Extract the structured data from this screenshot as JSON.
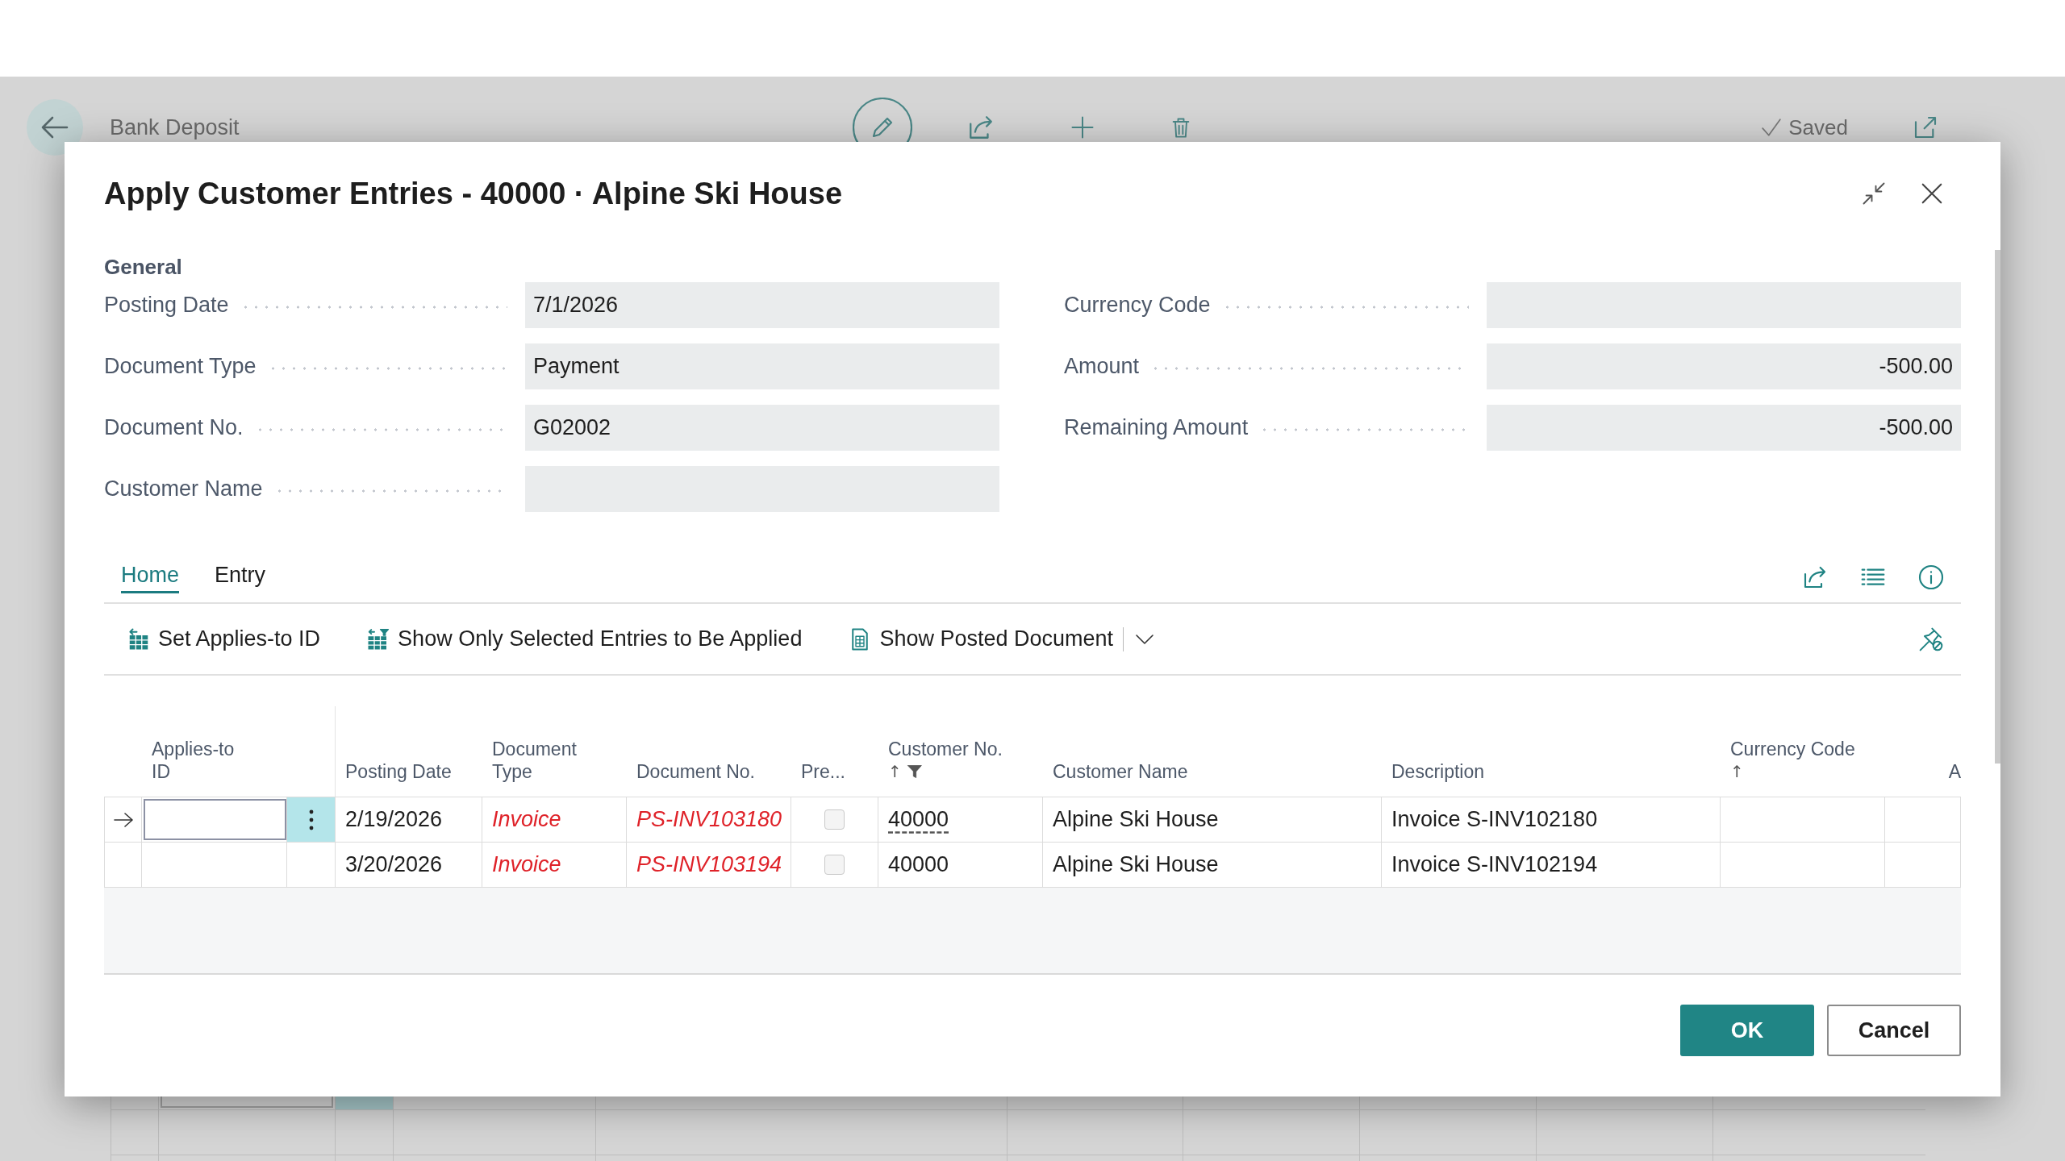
{
  "background_page": {
    "title": "Bank Deposit",
    "status": "Saved"
  },
  "dialog": {
    "title": "Apply Customer Entries - 40000 · Alpine Ski House",
    "group": "General",
    "left_fields": [
      {
        "label": "Posting Date",
        "value": "7/1/2026",
        "kind": "text"
      },
      {
        "label": "Document Type",
        "value": "Payment",
        "kind": "text"
      },
      {
        "label": "Document No.",
        "value": "G02002",
        "kind": "text"
      },
      {
        "label": "Customer Name"
      }
    ],
    "right_fields": [
      {
        "label": "Currency Code"
      },
      {
        "label": "Amount",
        "value": "-500.00",
        "kind": "amount"
      },
      {
        "label": "Remaining Amount",
        "value": "-500.00",
        "kind": "amount"
      }
    ],
    "tabs": [
      {
        "label": "Home",
        "selected": true
      },
      {
        "label": "Entry",
        "selected": false
      }
    ],
    "actions": [
      {
        "label": "Set Applies-to ID",
        "menu": false
      },
      {
        "label": "Show Only Selected Entries to Be Applied",
        "menu": false
      },
      {
        "label": "Show Posted Document",
        "menu": true
      }
    ],
    "table": {
      "columns": [
        {
          "label": "Applies-to ID"
        },
        {
          "label": "Posting Date"
        },
        {
          "label": "Document Type"
        },
        {
          "label": "Document No."
        },
        {
          "label": "Pre..."
        },
        {
          "label": "Customer No.",
          "sort_indicator": "↑",
          "filtered": true
        },
        {
          "label": "Customer Name"
        },
        {
          "label": "Description"
        },
        {
          "label": "Currency Code",
          "sort_indicator": "↑"
        },
        {
          "label": "A"
        }
      ],
      "rows": [
        {
          "selected": true,
          "posting_date": "2/19/2026",
          "document_type": "Invoice",
          "document_no": "PS-INV103180",
          "attention": true,
          "checked": false,
          "customer_no": "40000",
          "customer_name": "Alpine Ski House",
          "description": "Invoice S-INV102180"
        },
        {
          "selected": false,
          "posting_date": "3/20/2026",
          "document_type": "Invoice",
          "document_no": "PS-INV103194",
          "attention": true,
          "checked": false,
          "customer_no": "40000",
          "customer_name": "Alpine Ski House",
          "description": "Invoice S-INV102194"
        }
      ]
    },
    "buttons": [
      {
        "label": "OK",
        "kind": "primary"
      },
      {
        "label": "Cancel",
        "kind": "secondary"
      }
    ]
  }
}
